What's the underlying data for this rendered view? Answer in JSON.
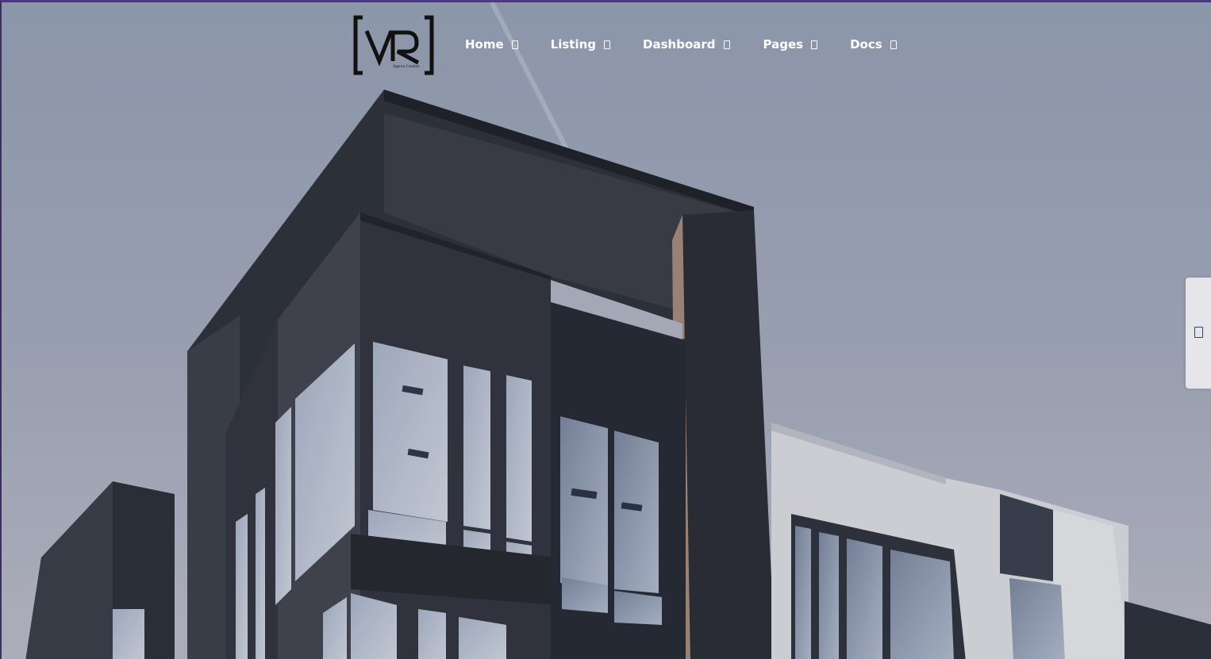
{
  "header": {
    "logo": {
      "mark": "VR",
      "tagline": "Agence Creative",
      "icon": "vr-brand-logo"
    },
    "nav": [
      {
        "label": "Home",
        "icon": "chevron-down-icon"
      },
      {
        "label": "Listing",
        "icon": "chevron-down-icon"
      },
      {
        "label": "Dashboard",
        "icon": "chevron-down-icon"
      },
      {
        "label": "Pages",
        "icon": "chevron-down-icon"
      },
      {
        "label": "Docs",
        "icon": "chevron-down-icon"
      }
    ]
  },
  "side_panel": {
    "icon": "settings-toggle-icon"
  },
  "hero": {
    "image": "modern-building-facade"
  },
  "colors": {
    "sky": "#a4abbd",
    "facade_dark": "#2a2d35",
    "nav_text": "#ffffff",
    "side_tab": "#e6e6ea",
    "frame_accent": "#4a3c7a"
  }
}
